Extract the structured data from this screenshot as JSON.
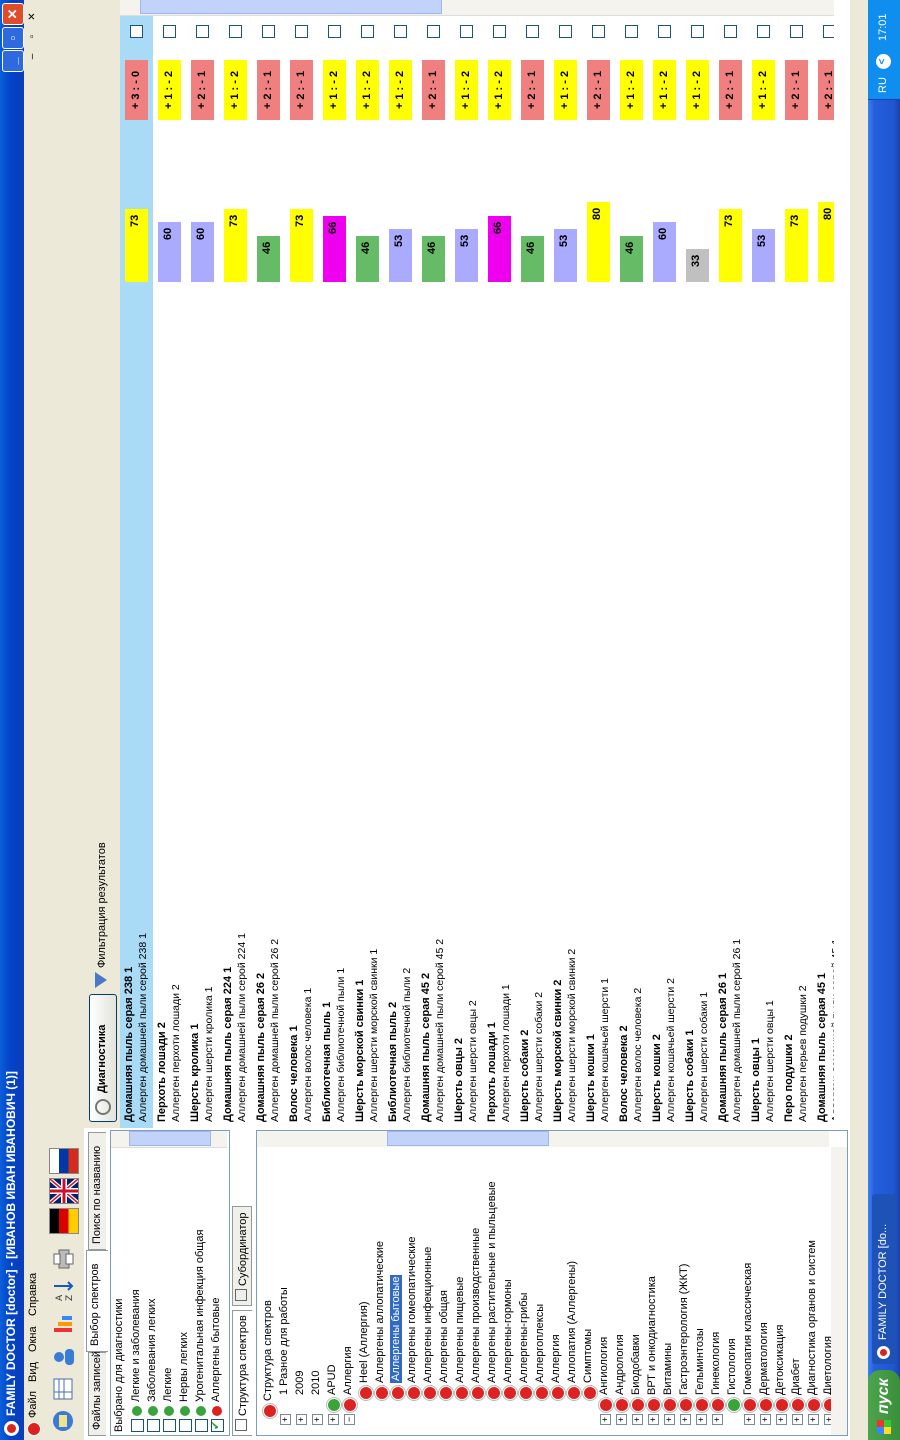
{
  "window": {
    "title": "FAMILY DOCTOR [doctor] - [ИВАНОВ ИВАН ИВАНОВИЧ (1)]",
    "min": "_",
    "max": "▫",
    "close": "✕"
  },
  "menu": {
    "file": "Файл",
    "view": "Вид",
    "windows": "Окна",
    "help": "Справка",
    "mdi_min": "–",
    "mdi_restore": "▫",
    "mdi_close": "✕"
  },
  "left": {
    "tabs": [
      "Файлы записей",
      "Выбор спектров",
      "Поиск по названию"
    ],
    "selected_header": "Выбрано для диагностики",
    "selected_items": [
      {
        "label": "Легкие и заболевания",
        "checked": false,
        "icon": "green"
      },
      {
        "label": "Заболевания легких",
        "checked": false,
        "icon": "green"
      },
      {
        "label": "Легкие",
        "checked": false,
        "icon": "green"
      },
      {
        "label": "Нервы легких",
        "checked": false,
        "icon": "green"
      },
      {
        "label": "Урогенитальная инфекция общая",
        "checked": false,
        "icon": "green"
      },
      {
        "label": "Аллергены бытовые",
        "checked": true,
        "icon": "red"
      }
    ],
    "subtabs": [
      "Структура спектров",
      "Субординатор"
    ],
    "tree": [
      {
        "label": "Структура спектров",
        "exp": "",
        "icon": "red",
        "level": 0
      },
      {
        "label": "1 Разное для работы",
        "exp": "+",
        "icon": "none",
        "level": 1
      },
      {
        "label": "2009",
        "exp": "+",
        "icon": "none",
        "level": 1
      },
      {
        "label": "2010",
        "exp": "+",
        "icon": "none",
        "level": 1
      },
      {
        "label": "APUD",
        "exp": "+",
        "icon": "green",
        "level": 1
      },
      {
        "label": "Аллергия",
        "exp": "−",
        "icon": "red",
        "level": 1
      },
      {
        "label": "Heel (Аллергия)",
        "exp": "",
        "icon": "red",
        "level": 2
      },
      {
        "label": "Аллергены аллопатические",
        "exp": "",
        "icon": "red",
        "level": 2
      },
      {
        "label": "Аллергены бытовые",
        "exp": "",
        "icon": "red",
        "level": 2,
        "selected": true
      },
      {
        "label": "Аллергены гомеопатические",
        "exp": "",
        "icon": "red",
        "level": 2
      },
      {
        "label": "Аллергены инфекционные",
        "exp": "",
        "icon": "red",
        "level": 2
      },
      {
        "label": "Аллергены общая",
        "exp": "",
        "icon": "red",
        "level": 2
      },
      {
        "label": "Аллергены пищевые",
        "exp": "",
        "icon": "red",
        "level": 2
      },
      {
        "label": "Аллергены производственные",
        "exp": "",
        "icon": "red",
        "level": 2
      },
      {
        "label": "Аллергены растительные и пыльцевые",
        "exp": "",
        "icon": "red",
        "level": 2
      },
      {
        "label": "Аллергены-гормоны",
        "exp": "",
        "icon": "red",
        "level": 2
      },
      {
        "label": "Аллергены-грибы",
        "exp": "",
        "icon": "red",
        "level": 2
      },
      {
        "label": "Аллергоплексы",
        "exp": "",
        "icon": "red",
        "level": 2
      },
      {
        "label": "Аллергия",
        "exp": "",
        "icon": "red",
        "level": 2
      },
      {
        "label": "Аллопатия (Аллергены)",
        "exp": "",
        "icon": "red",
        "level": 2
      },
      {
        "label": "Симптомы",
        "exp": "",
        "icon": "red",
        "level": 2
      },
      {
        "label": "Ангиология",
        "exp": "+",
        "icon": "red",
        "level": 1
      },
      {
        "label": "Андрология",
        "exp": "+",
        "icon": "red",
        "level": 1
      },
      {
        "label": "Биодобавки",
        "exp": "+",
        "icon": "red",
        "level": 1
      },
      {
        "label": "ВРТ и онкодиагностика",
        "exp": "+",
        "icon": "red",
        "level": 1
      },
      {
        "label": "Витамины",
        "exp": "+",
        "icon": "red",
        "level": 1
      },
      {
        "label": "Гастроэнтерология (ЖКТ)",
        "exp": "+",
        "icon": "red",
        "level": 1
      },
      {
        "label": "Гельминтозы",
        "exp": "+",
        "icon": "red",
        "level": 1
      },
      {
        "label": "Гинекология",
        "exp": "+",
        "icon": "red",
        "level": 1
      },
      {
        "label": "Гистология",
        "exp": "",
        "icon": "green",
        "level": 1
      },
      {
        "label": "Гомеопатия классическая",
        "exp": "+",
        "icon": "red",
        "level": 1
      },
      {
        "label": "Дерматология",
        "exp": "+",
        "icon": "red",
        "level": 1
      },
      {
        "label": "Детоксикация",
        "exp": "+",
        "icon": "red",
        "level": 1
      },
      {
        "label": "Диабет",
        "exp": "+",
        "icon": "red",
        "level": 1
      },
      {
        "label": "Диагностика органов и систем",
        "exp": "+",
        "icon": "red",
        "level": 1
      },
      {
        "label": "Диетология",
        "exp": "+",
        "icon": "red",
        "level": 1
      }
    ]
  },
  "right": {
    "diag_button": "Диагностика",
    "filter_button": "Фильтрация результатов",
    "rows": [
      {
        "name": "Домашняя пыль серая 238 1",
        "desc": "Аллерген домашней пыли серой 238 1",
        "value": 73,
        "color": "#ffff00",
        "rating": "+ 3 : - 0",
        "rcolor": "#f08080",
        "selected": true
      },
      {
        "name": "Перхоть лошади 2",
        "desc": "Аллерген перхоти лошади 2",
        "value": 60,
        "color": "#aaaaff",
        "rating": "+ 1 : - 2",
        "rcolor": "#ffff00"
      },
      {
        "name": "Шерсть кролика 1",
        "desc": "Аллерген шерсти кролика 1",
        "value": 60,
        "color": "#aaaaff",
        "rating": "+ 2 : - 1",
        "rcolor": "#f08080"
      },
      {
        "name": "Домашняя пыль серая 224 1",
        "desc": "Аллерген домашней пыли серой 224 1",
        "value": 73,
        "color": "#ffff00",
        "rating": "+ 1 : - 2",
        "rcolor": "#ffff00"
      },
      {
        "name": "Домашняя пыль серая 26 2",
        "desc": "Аллерген домашней пыли серой 26 2",
        "value": 46,
        "color": "#66bb66",
        "rating": "+ 2 : - 1",
        "rcolor": "#f08080"
      },
      {
        "name": "Волос человека 1",
        "desc": "Аллерген волос человека 1",
        "value": 73,
        "color": "#ffff00",
        "rating": "+ 2 : - 1",
        "rcolor": "#f08080"
      },
      {
        "name": "Библиотечная пыль 1",
        "desc": "Аллерген библиотечной пыли 1",
        "value": 66,
        "color": "#ee00ee",
        "rating": "+ 1 : - 2",
        "rcolor": "#ffff00"
      },
      {
        "name": "Шерсть морской свинки 1",
        "desc": "Аллерген шерсти морской свинки 1",
        "value": 46,
        "color": "#66bb66",
        "rating": "+ 1 : - 2",
        "rcolor": "#ffff00"
      },
      {
        "name": "Библиотечная пыль 2",
        "desc": "Аллерген библиотечной пыли 2",
        "value": 53,
        "color": "#aaaaff",
        "rating": "+ 1 : - 2",
        "rcolor": "#ffff00"
      },
      {
        "name": "Домашняя пыль серая 45 2",
        "desc": "Аллерген домашней пыли серой 45 2",
        "value": 46,
        "color": "#66bb66",
        "rating": "+ 2 : - 1",
        "rcolor": "#f08080"
      },
      {
        "name": "Шерсть овцы 2",
        "desc": "Аллерген шерсти овцы 2",
        "value": 53,
        "color": "#aaaaff",
        "rating": "+ 1 : - 2",
        "rcolor": "#ffff00"
      },
      {
        "name": "Перхоть лошади 1",
        "desc": "Аллерген перхоти лошади 1",
        "value": 66,
        "color": "#ee00ee",
        "rating": "+ 1 : - 2",
        "rcolor": "#ffff00"
      },
      {
        "name": "Шерсть собаки 2",
        "desc": "Аллерген шерсти собаки 2",
        "value": 46,
        "color": "#66bb66",
        "rating": "+ 2 : - 1",
        "rcolor": "#f08080"
      },
      {
        "name": "Шерсть морской свинки 2",
        "desc": "Аллерген шерсти морской свинки 2",
        "value": 53,
        "color": "#aaaaff",
        "rating": "+ 1 : - 2",
        "rcolor": "#ffff00"
      },
      {
        "name": "Шерсть кошки 1",
        "desc": "Аллерген кошачьей шерсти 1",
        "value": 80,
        "color": "#ffff00",
        "rating": "+ 2 : - 1",
        "rcolor": "#f08080"
      },
      {
        "name": "Волос человека 2",
        "desc": "Аллерген волос человека 2",
        "value": 46,
        "color": "#66bb66",
        "rating": "+ 1 : - 2",
        "rcolor": "#ffff00"
      },
      {
        "name": "Шерсть кошки 2",
        "desc": "Аллерген кошачьей шерсти 2",
        "value": 60,
        "color": "#aaaaff",
        "rating": "+ 1 : - 2",
        "rcolor": "#ffff00"
      },
      {
        "name": "Шерсть собаки 1",
        "desc": "Аллерген шерсти собаки 1",
        "value": 33,
        "color": "#c0c0c0",
        "rating": "+ 1 : - 2",
        "rcolor": "#ffff00"
      },
      {
        "name": "Домашняя пыль серая 26 1",
        "desc": "Аллерген домашней пыли серой 26 1",
        "value": 73,
        "color": "#ffff00",
        "rating": "+ 2 : - 1",
        "rcolor": "#f08080"
      },
      {
        "name": "Шерсть овцы 1",
        "desc": "Аллерген шерсти овцы 1",
        "value": 53,
        "color": "#aaaaff",
        "rating": "+ 1 : - 2",
        "rcolor": "#ffff00"
      },
      {
        "name": "Перо подушки 2",
        "desc": "Аллерген перьев подушки 2",
        "value": 73,
        "color": "#ffff00",
        "rating": "+ 2 : - 1",
        "rcolor": "#f08080"
      },
      {
        "name": "Домашняя пыль серая 45 1",
        "desc": "Аллерген домашней пыли серой 45 1",
        "value": 80,
        "color": "#ffff00",
        "rating": "+ 2 : - 1",
        "rcolor": "#f08080"
      }
    ]
  },
  "taskbar": {
    "start": "пуск",
    "task": "FAMILY DOCTOR [do...",
    "lang": "RU",
    "chevron": "<",
    "clock": "17:01"
  }
}
